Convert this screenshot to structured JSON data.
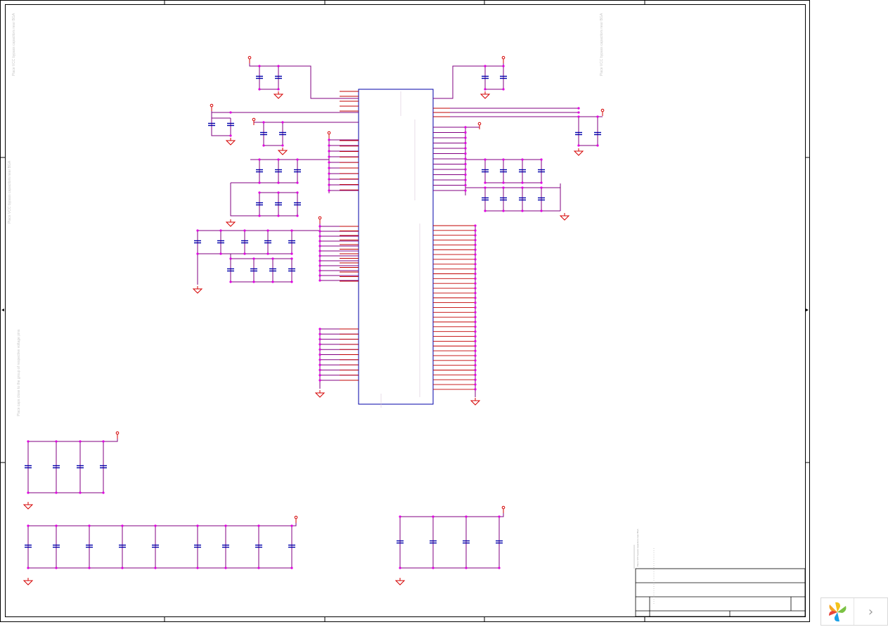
{
  "sheet": {
    "notes": [
      "Place VCC bypass capacitors near BGA",
      "Place VCC bypass capacitors near BGA",
      "Place VCC bypass capacitors near BGA",
      "Place caps close to the group of respective voltage pins",
      "Place VCC bypass capacitors near BGA"
    ]
  },
  "colors": {
    "wire": "#800080",
    "pin": "#c00000",
    "component": "#0000aa",
    "power": "#d40000",
    "junction": "#e000e0",
    "border": "#000000"
  },
  "viewer": {
    "logo_icon": "pinwheel-logo-icon",
    "next_label": "›"
  }
}
